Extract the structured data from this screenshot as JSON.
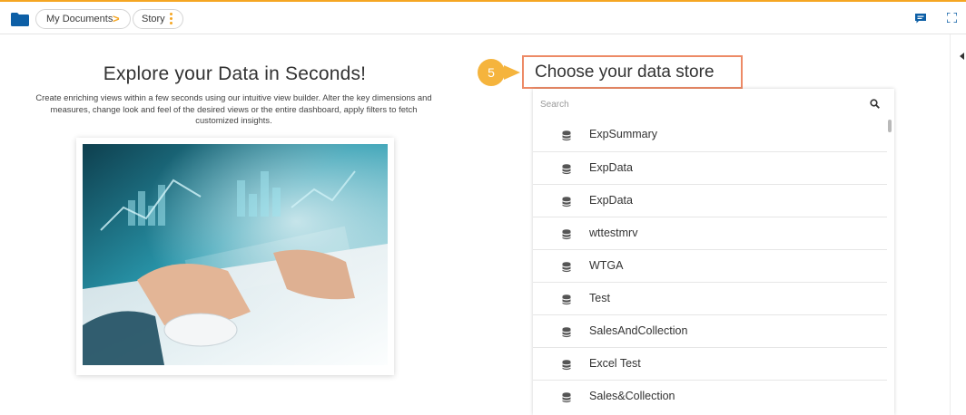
{
  "breadcrumb": {
    "items": [
      {
        "label": "My Documents"
      },
      {
        "label": "Story"
      }
    ]
  },
  "icons": {
    "folder": "folder-icon",
    "chevron": "chevron-right-icon",
    "menu": "kebab-menu-icon",
    "comment": "comment-icon",
    "expand": "expand-icon",
    "search": "search-icon",
    "datastore": "database-icon"
  },
  "intro": {
    "title": "Explore your Data in Seconds!",
    "description": "Create enriching views within a few seconds using our intuitive view builder. Alter the key dimensions and measures, change look and feel of the desired views or the entire dashboard, apply filters to fetch customized insights."
  },
  "step": {
    "number": "5",
    "title": "Choose your data store"
  },
  "search": {
    "placeholder": "Search",
    "value": ""
  },
  "datastores": [
    {
      "label": "ExpSummary"
    },
    {
      "label": "ExpData"
    },
    {
      "label": "ExpData"
    },
    {
      "label": "wttestmrv"
    },
    {
      "label": "WTGA"
    },
    {
      "label": "Test"
    },
    {
      "label": "SalesAndCollection"
    },
    {
      "label": "Excel Test"
    },
    {
      "label": "Sales&Collection"
    }
  ],
  "colors": {
    "accent": "#f5a623",
    "highlight": "#ed8a66",
    "badge": "#f5b43d",
    "folder": "#0d5fa6"
  }
}
